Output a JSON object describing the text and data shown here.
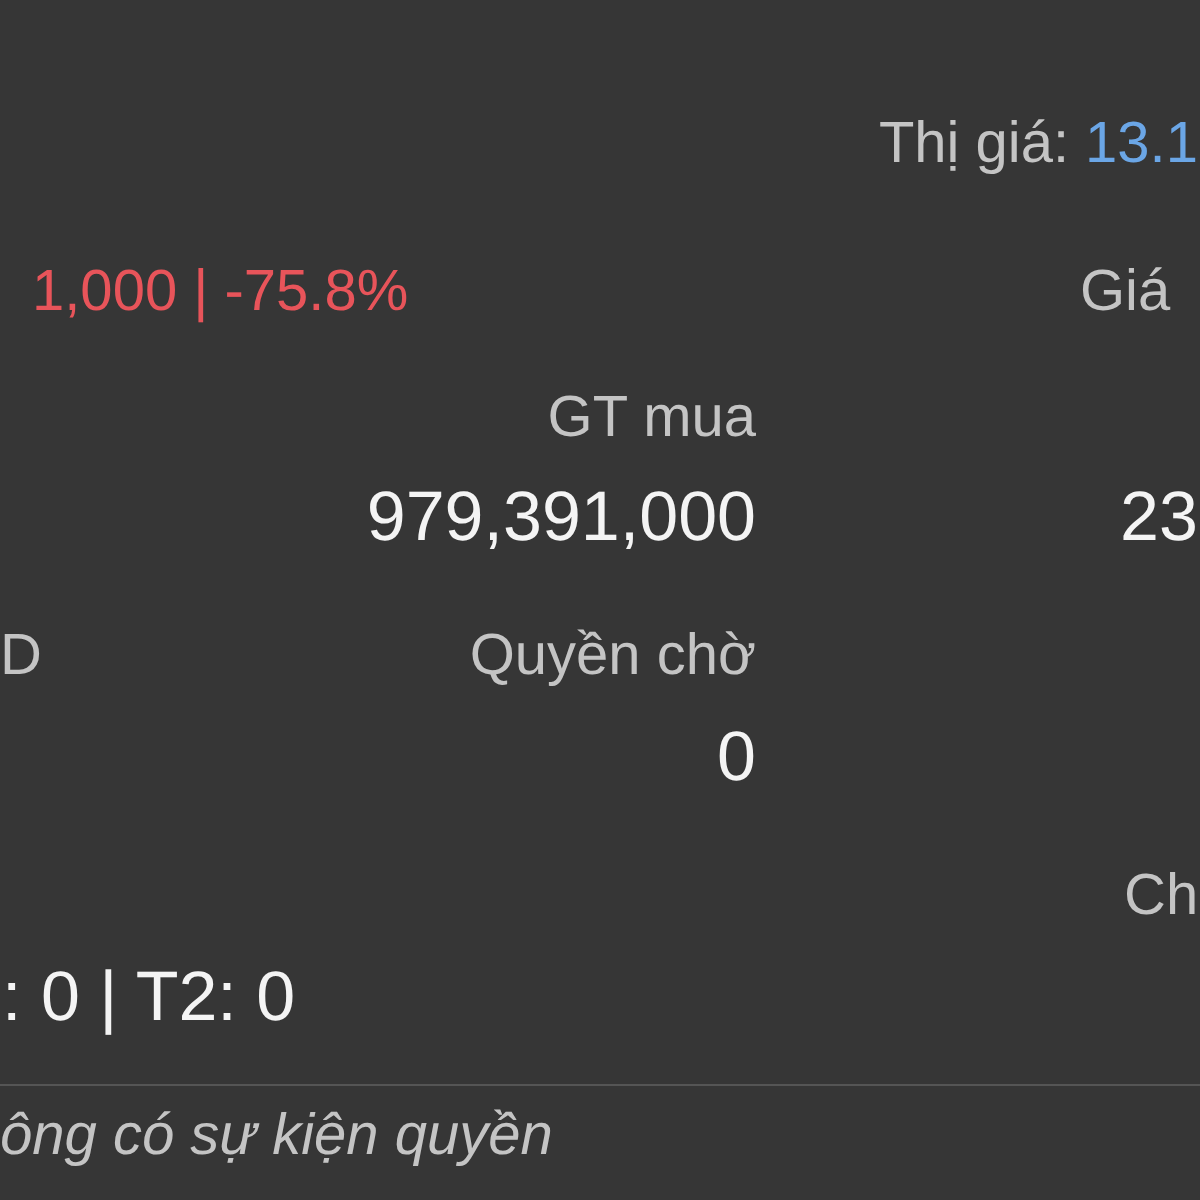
{
  "market_price": {
    "label": "Thị giá:",
    "value": "13.1"
  },
  "rows": [
    {
      "column_1": {
        "kind": "change",
        "text": "1,000 | -75.8%",
        "negative": true
      },
      "column_3": {
        "kind": "label",
        "text": "Giá"
      }
    },
    {
      "column_2": {
        "kind": "label",
        "text": "GT mua"
      }
    },
    {
      "column_2": {
        "kind": "value",
        "text": "979,391,000"
      },
      "column_3": {
        "kind": "value",
        "text": "23"
      }
    },
    {
      "column_1": {
        "kind": "label",
        "text": "D"
      },
      "column_2": {
        "kind": "label",
        "text": "Quyền chờ"
      }
    },
    {
      "column_2": {
        "kind": "value",
        "text": "0"
      }
    },
    {
      "column_3": {
        "kind": "label",
        "text": "Ch"
      }
    },
    {
      "column_1": {
        "kind": "value",
        "text": ": 0 | T2: 0"
      }
    }
  ],
  "rights_event_note": "ông có sự kiện quyền"
}
